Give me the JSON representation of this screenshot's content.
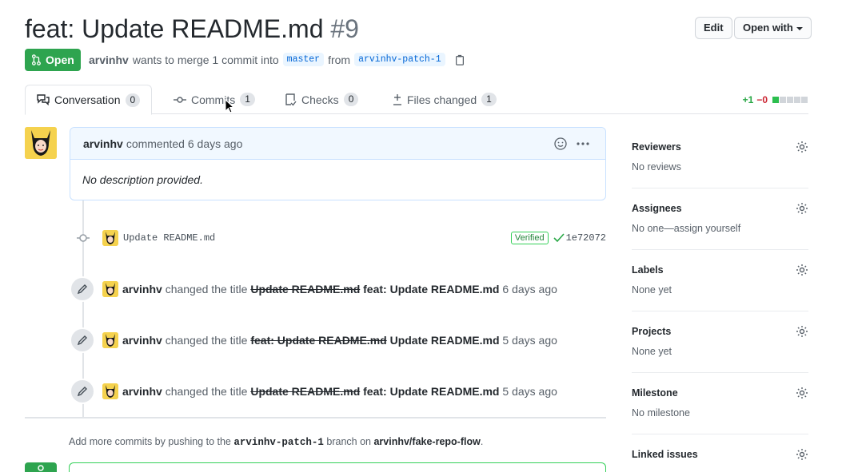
{
  "header": {
    "title": "feat: Update README.md",
    "number": "#9",
    "edit_label": "Edit",
    "open_with_label": "Open with"
  },
  "state": {
    "label": "Open",
    "author": "arvinhv",
    "merge_text": "wants to merge 1 commit into",
    "base_branch": "master",
    "from_text": "from",
    "head_branch": "arvinhv-patch-1"
  },
  "tabs": [
    {
      "label": "Conversation",
      "count": "0"
    },
    {
      "label": "Commits",
      "count": "1"
    },
    {
      "label": "Checks",
      "count": "0"
    },
    {
      "label": "Files changed",
      "count": "1"
    }
  ],
  "diffstat": {
    "additions": "+1",
    "deletions": "−0"
  },
  "comment": {
    "author": "arvinhv",
    "action": "commented",
    "time": "6 days ago",
    "body": "No description provided."
  },
  "commit": {
    "message": "Update README.md",
    "verified": "Verified",
    "sha": "1e72072"
  },
  "events": [
    {
      "actor": "arvinhv",
      "action": "changed the title",
      "old": "Update README.md",
      "new": "feat: Update README.md",
      "time": "6 days ago"
    },
    {
      "actor": "arvinhv",
      "action": "changed the title",
      "old": "feat: Update README.md",
      "new": "Update README.md",
      "time": "5 days ago"
    },
    {
      "actor": "arvinhv",
      "action": "changed the title",
      "old": "Update README.md",
      "new": "feat: Update README.md",
      "time": "5 days ago"
    }
  ],
  "footer": {
    "pre": "Add more commits by pushing to the",
    "branch": "arvinhv-patch-1",
    "mid": "branch on",
    "repo": "arvinhv/fake-repo-flow",
    "post": "."
  },
  "sidebar": [
    {
      "title": "Reviewers",
      "value": "No reviews"
    },
    {
      "title": "Assignees",
      "value": "No one—assign yourself"
    },
    {
      "title": "Labels",
      "value": "None yet"
    },
    {
      "title": "Projects",
      "value": "None yet"
    },
    {
      "title": "Milestone",
      "value": "No milestone"
    },
    {
      "title": "Linked issues",
      "value": ""
    }
  ],
  "colors": {
    "open_green": "#2ea44f",
    "link_blue": "#0366d6",
    "deletion_red": "#cb2431"
  }
}
